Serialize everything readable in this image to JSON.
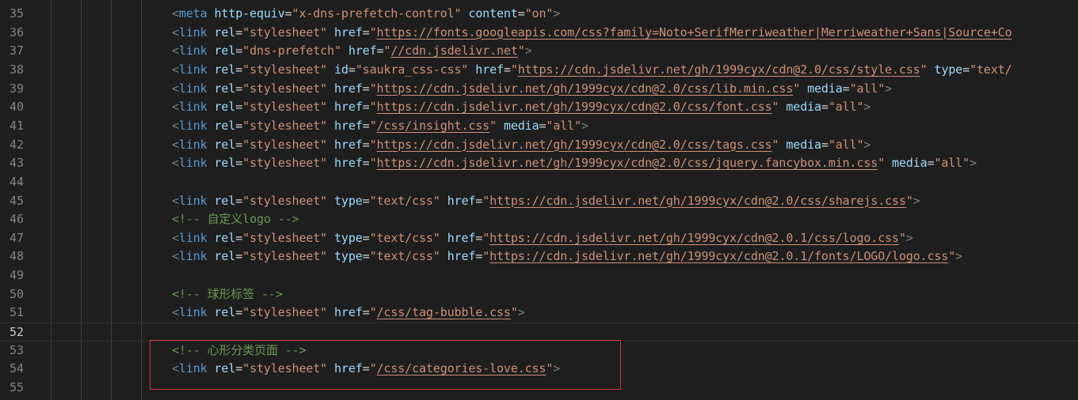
{
  "editor": {
    "language": "html",
    "first_line_number": 35,
    "current_line": 52,
    "colors": {
      "background": "#1e1e1e",
      "line_number": "#858585",
      "tag": "#569cd6",
      "attribute": "#9cdcfe",
      "string": "#ce9178",
      "comment": "#6a9955",
      "punctuation": "#808080",
      "highlight_box": "#d8343a"
    },
    "lines": [
      {
        "n": "35",
        "t": [
          [
            "pun",
            "<"
          ],
          [
            "tag",
            "meta"
          ],
          [
            "sp",
            " "
          ],
          [
            "attr",
            "http-equiv"
          ],
          [
            "eq",
            "="
          ],
          [
            "str",
            "\"x-dns-prefetch-control\""
          ],
          [
            "sp",
            " "
          ],
          [
            "attr",
            "content"
          ],
          [
            "eq",
            "="
          ],
          [
            "str",
            "\"on\""
          ],
          [
            "pun",
            ">"
          ]
        ]
      },
      {
        "n": "36",
        "t": [
          [
            "pun",
            "<"
          ],
          [
            "tag",
            "link"
          ],
          [
            "sp",
            " "
          ],
          [
            "attr",
            "rel"
          ],
          [
            "eq",
            "="
          ],
          [
            "str",
            "\"stylesheet\""
          ],
          [
            "sp",
            " "
          ],
          [
            "attr",
            "href"
          ],
          [
            "eq",
            "="
          ],
          [
            "str",
            "\""
          ],
          [
            "url",
            "https://fonts.googleapis.com/css?family=Noto+SerifMerriweather|Merriweather+Sans|Source+Co"
          ]
        ]
      },
      {
        "n": "37",
        "t": [
          [
            "pun",
            "<"
          ],
          [
            "tag",
            "link"
          ],
          [
            "sp",
            " "
          ],
          [
            "attr",
            "rel"
          ],
          [
            "eq",
            "="
          ],
          [
            "str",
            "\"dns-prefetch\""
          ],
          [
            "sp",
            " "
          ],
          [
            "attr",
            "href"
          ],
          [
            "eq",
            "="
          ],
          [
            "str",
            "\""
          ],
          [
            "url",
            "//cdn.jsdelivr.net"
          ],
          [
            "str",
            "\""
          ],
          [
            "pun",
            ">"
          ]
        ]
      },
      {
        "n": "38",
        "t": [
          [
            "pun",
            "<"
          ],
          [
            "tag",
            "link"
          ],
          [
            "sp",
            " "
          ],
          [
            "attr",
            "rel"
          ],
          [
            "eq",
            "="
          ],
          [
            "str",
            "\"stylesheet\""
          ],
          [
            "sp",
            " "
          ],
          [
            "attr",
            "id"
          ],
          [
            "eq",
            "="
          ],
          [
            "str",
            "\"saukra_css-css\""
          ],
          [
            "sp",
            " "
          ],
          [
            "attr",
            "href"
          ],
          [
            "eq",
            "="
          ],
          [
            "str",
            "\""
          ],
          [
            "url",
            "https://cdn.jsdelivr.net/gh/1999cyx/cdn@2.0/css/style.css"
          ],
          [
            "str",
            "\""
          ],
          [
            "sp",
            " "
          ],
          [
            "attr",
            "type"
          ],
          [
            "eq",
            "="
          ],
          [
            "str",
            "\"text/"
          ]
        ]
      },
      {
        "n": "39",
        "t": [
          [
            "pun",
            "<"
          ],
          [
            "tag",
            "link"
          ],
          [
            "sp",
            " "
          ],
          [
            "attr",
            "rel"
          ],
          [
            "eq",
            "="
          ],
          [
            "str",
            "\"stylesheet\""
          ],
          [
            "sp",
            " "
          ],
          [
            "attr",
            "href"
          ],
          [
            "eq",
            "="
          ],
          [
            "str",
            "\""
          ],
          [
            "url",
            "https://cdn.jsdelivr.net/gh/1999cyx/cdn@2.0/css/lib.min.css"
          ],
          [
            "str",
            "\""
          ],
          [
            "sp",
            " "
          ],
          [
            "attr",
            "media"
          ],
          [
            "eq",
            "="
          ],
          [
            "str",
            "\"all\""
          ],
          [
            "pun",
            ">"
          ]
        ]
      },
      {
        "n": "40",
        "t": [
          [
            "pun",
            "<"
          ],
          [
            "tag",
            "link"
          ],
          [
            "sp",
            " "
          ],
          [
            "attr",
            "rel"
          ],
          [
            "eq",
            "="
          ],
          [
            "str",
            "\"stylesheet\""
          ],
          [
            "sp",
            " "
          ],
          [
            "attr",
            "href"
          ],
          [
            "eq",
            "="
          ],
          [
            "str",
            "\""
          ],
          [
            "url",
            "https://cdn.jsdelivr.net/gh/1999cyx/cdn@2.0/css/font.css"
          ],
          [
            "str",
            "\""
          ],
          [
            "sp",
            " "
          ],
          [
            "attr",
            "media"
          ],
          [
            "eq",
            "="
          ],
          [
            "str",
            "\"all\""
          ],
          [
            "pun",
            ">"
          ]
        ]
      },
      {
        "n": "41",
        "t": [
          [
            "pun",
            "<"
          ],
          [
            "tag",
            "link"
          ],
          [
            "sp",
            " "
          ],
          [
            "attr",
            "rel"
          ],
          [
            "eq",
            "="
          ],
          [
            "str",
            "\"stylesheet\""
          ],
          [
            "sp",
            " "
          ],
          [
            "attr",
            "href"
          ],
          [
            "eq",
            "="
          ],
          [
            "str",
            "\""
          ],
          [
            "url",
            "/css/insight.css"
          ],
          [
            "str",
            "\""
          ],
          [
            "sp",
            " "
          ],
          [
            "attr",
            "media"
          ],
          [
            "eq",
            "="
          ],
          [
            "str",
            "\"all\""
          ],
          [
            "pun",
            ">"
          ]
        ]
      },
      {
        "n": "42",
        "t": [
          [
            "pun",
            "<"
          ],
          [
            "tag",
            "link"
          ],
          [
            "sp",
            " "
          ],
          [
            "attr",
            "rel"
          ],
          [
            "eq",
            "="
          ],
          [
            "str",
            "\"stylesheet\""
          ],
          [
            "sp",
            " "
          ],
          [
            "attr",
            "href"
          ],
          [
            "eq",
            "="
          ],
          [
            "str",
            "\""
          ],
          [
            "url",
            "https://cdn.jsdelivr.net/gh/1999cyx/cdn@2.0/css/tags.css"
          ],
          [
            "str",
            "\""
          ],
          [
            "sp",
            " "
          ],
          [
            "attr",
            "media"
          ],
          [
            "eq",
            "="
          ],
          [
            "str",
            "\"all\""
          ],
          [
            "pun",
            ">"
          ]
        ]
      },
      {
        "n": "43",
        "t": [
          [
            "pun",
            "<"
          ],
          [
            "tag",
            "link"
          ],
          [
            "sp",
            " "
          ],
          [
            "attr",
            "rel"
          ],
          [
            "eq",
            "="
          ],
          [
            "str",
            "\"stylesheet\""
          ],
          [
            "sp",
            " "
          ],
          [
            "attr",
            "href"
          ],
          [
            "eq",
            "="
          ],
          [
            "str",
            "\""
          ],
          [
            "url",
            "https://cdn.jsdelivr.net/gh/1999cyx/cdn@2.0/css/jquery.fancybox.min.css"
          ],
          [
            "str",
            "\""
          ],
          [
            "sp",
            " "
          ],
          [
            "attr",
            "media"
          ],
          [
            "eq",
            "="
          ],
          [
            "str",
            "\"all\""
          ],
          [
            "pun",
            ">"
          ]
        ]
      },
      {
        "n": "44",
        "t": []
      },
      {
        "n": "45",
        "t": [
          [
            "pun",
            "<"
          ],
          [
            "tag",
            "link"
          ],
          [
            "sp",
            " "
          ],
          [
            "attr",
            "rel"
          ],
          [
            "eq",
            "="
          ],
          [
            "str",
            "\"stylesheet\""
          ],
          [
            "sp",
            " "
          ],
          [
            "attr",
            "type"
          ],
          [
            "eq",
            "="
          ],
          [
            "str",
            "\"text/css\""
          ],
          [
            "sp",
            " "
          ],
          [
            "attr",
            "href"
          ],
          [
            "eq",
            "="
          ],
          [
            "str",
            "\""
          ],
          [
            "url",
            "https://cdn.jsdelivr.net/gh/1999cyx/cdn@2.0/css/sharejs.css"
          ],
          [
            "str",
            "\""
          ],
          [
            "pun",
            ">"
          ]
        ]
      },
      {
        "n": "46",
        "t": [
          [
            "com",
            "<!-- "
          ],
          [
            "comcjk",
            "自定义"
          ],
          [
            "com",
            "logo -->"
          ]
        ]
      },
      {
        "n": "47",
        "t": [
          [
            "pun",
            "<"
          ],
          [
            "tag",
            "link"
          ],
          [
            "sp",
            " "
          ],
          [
            "attr",
            "rel"
          ],
          [
            "eq",
            "="
          ],
          [
            "str",
            "\"stylesheet\""
          ],
          [
            "sp",
            " "
          ],
          [
            "attr",
            "type"
          ],
          [
            "eq",
            "="
          ],
          [
            "str",
            "\"text/css\""
          ],
          [
            "sp",
            " "
          ],
          [
            "attr",
            "href"
          ],
          [
            "eq",
            "="
          ],
          [
            "str",
            "\""
          ],
          [
            "url",
            "https://cdn.jsdelivr.net/gh/1999cyx/cdn@2.0.1/css/logo.css"
          ],
          [
            "str",
            "\""
          ],
          [
            "pun",
            ">"
          ]
        ]
      },
      {
        "n": "48",
        "t": [
          [
            "pun",
            "<"
          ],
          [
            "tag",
            "link"
          ],
          [
            "sp",
            " "
          ],
          [
            "attr",
            "rel"
          ],
          [
            "eq",
            "="
          ],
          [
            "str",
            "\"stylesheet\""
          ],
          [
            "sp",
            " "
          ],
          [
            "attr",
            "type"
          ],
          [
            "eq",
            "="
          ],
          [
            "str",
            "\"text/css\""
          ],
          [
            "sp",
            " "
          ],
          [
            "attr",
            "href"
          ],
          [
            "eq",
            "="
          ],
          [
            "str",
            "\""
          ],
          [
            "url",
            "https://cdn.jsdelivr.net/gh/1999cyx/cdn@2.0.1/fonts/LOGO/logo.css"
          ],
          [
            "str",
            "\""
          ],
          [
            "pun",
            ">"
          ]
        ]
      },
      {
        "n": "49",
        "t": []
      },
      {
        "n": "50",
        "t": [
          [
            "com",
            "<!-- "
          ],
          [
            "comcjk",
            "球形标签"
          ],
          [
            "com",
            " -->"
          ]
        ]
      },
      {
        "n": "51",
        "t": [
          [
            "pun",
            "<"
          ],
          [
            "tag",
            "link"
          ],
          [
            "sp",
            " "
          ],
          [
            "attr",
            "rel"
          ],
          [
            "eq",
            "="
          ],
          [
            "str",
            "\"stylesheet\""
          ],
          [
            "sp",
            " "
          ],
          [
            "attr",
            "href"
          ],
          [
            "eq",
            "="
          ],
          [
            "str",
            "\""
          ],
          [
            "url",
            "/css/tag-bubble.css"
          ],
          [
            "str",
            "\""
          ],
          [
            "pun",
            ">"
          ]
        ]
      },
      {
        "n": "52",
        "t": []
      },
      {
        "n": "53",
        "t": [
          [
            "com",
            "<!-- "
          ],
          [
            "comcjk",
            "心形分类页面"
          ],
          [
            "com",
            " -->"
          ]
        ]
      },
      {
        "n": "54",
        "t": [
          [
            "pun",
            "<"
          ],
          [
            "tag",
            "link"
          ],
          [
            "sp",
            " "
          ],
          [
            "attr",
            "rel"
          ],
          [
            "eq",
            "="
          ],
          [
            "str",
            "\"stylesheet\""
          ],
          [
            "sp",
            " "
          ],
          [
            "attr",
            "href"
          ],
          [
            "eq",
            "="
          ],
          [
            "str",
            "\""
          ],
          [
            "url",
            "/css/categories-love.css"
          ],
          [
            "str",
            "\""
          ],
          [
            "pun",
            ">"
          ]
        ]
      },
      {
        "n": "55",
        "t": []
      }
    ]
  }
}
